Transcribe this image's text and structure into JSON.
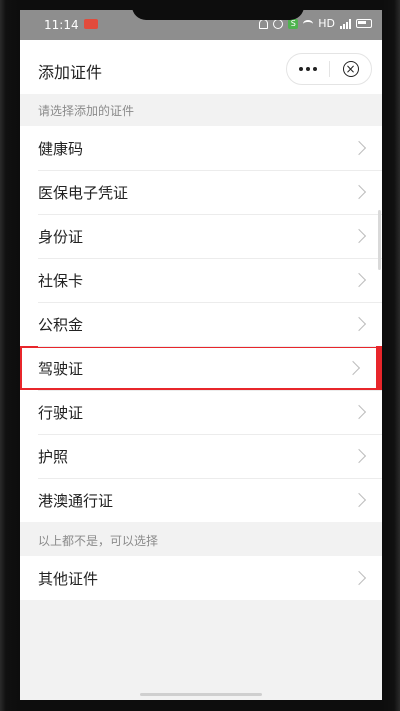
{
  "status_bar": {
    "time": "11:14",
    "network": "HD"
  },
  "header": {
    "title": "添加证件"
  },
  "section_hint_1": "请选择添加的证件",
  "documents": [
    {
      "label": "健康码"
    },
    {
      "label": "医保电子凭证"
    },
    {
      "label": "身份证"
    },
    {
      "label": "社保卡"
    },
    {
      "label": "公积金"
    },
    {
      "label": "驾驶证",
      "highlighted": true
    },
    {
      "label": "行驶证"
    },
    {
      "label": "护照"
    },
    {
      "label": "港澳通行证"
    }
  ],
  "section_hint_2": "以上都不是，可以选择",
  "other": {
    "label": "其他证件"
  },
  "colors": {
    "highlight": "#e8262b",
    "status_bar": "#8e8e8e",
    "background": "#f2f2f2"
  }
}
